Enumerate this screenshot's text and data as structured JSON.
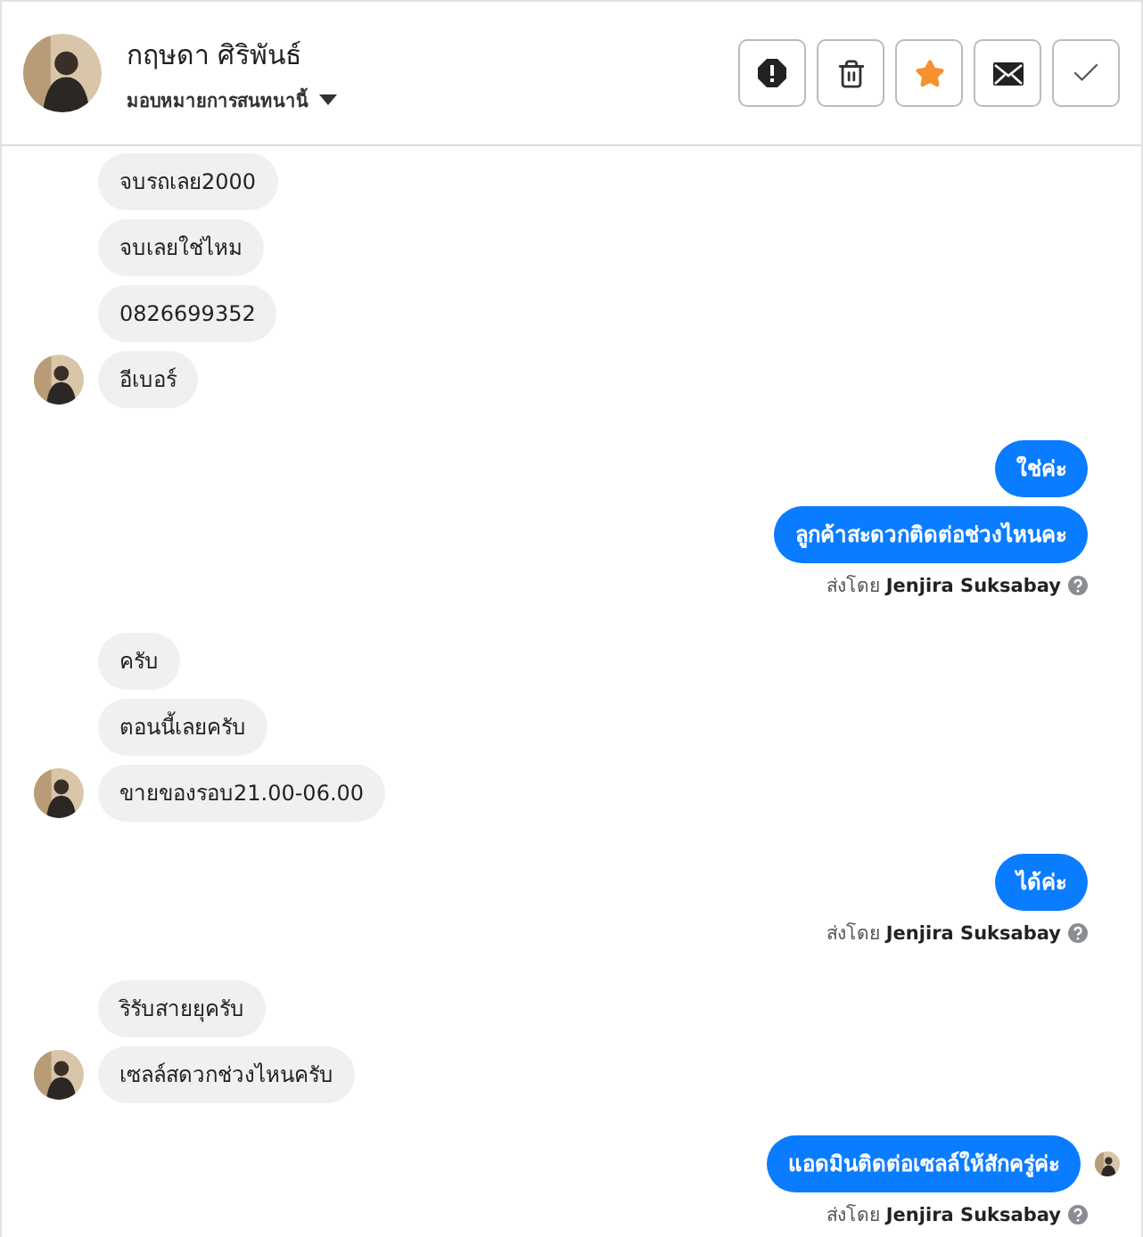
{
  "header": {
    "name": "กฤษดา ศิริพันธ์",
    "assign_label": "มอบหมายการสนทนานี้",
    "actions": [
      {
        "kind": "spam"
      },
      {
        "kind": "delete"
      },
      {
        "kind": "star",
        "selected": true
      },
      {
        "kind": "unread"
      },
      {
        "kind": "done"
      }
    ]
  },
  "groups": [
    {
      "kind": "incoming",
      "messages": [
        "จบรถเลย2000",
        "จบเลยใช่ไหม",
        "0826699352",
        "อีเบอร์"
      ]
    },
    {
      "kind": "outgoing",
      "messages": [
        "ใช่ค่ะ",
        "ลูกค้าสะดวกติดต่อช่วงไหนคะ"
      ],
      "sent_by_label": "ส่งโดย",
      "sender": "Jenjira Suksabay",
      "seen": false
    },
    {
      "kind": "incoming",
      "messages": [
        "ครับ",
        "ตอนนี้เลยครับ",
        "ขายของรอบ21.00-06.00"
      ]
    },
    {
      "kind": "outgoing",
      "messages": [
        "ได้ค่ะ"
      ],
      "sent_by_label": "ส่งโดย",
      "sender": "Jenjira Suksabay",
      "seen": false
    },
    {
      "kind": "incoming",
      "messages": [
        "ริรับสายยุครับ",
        "เซลล์สดวกช่วงไหนครับ"
      ]
    },
    {
      "kind": "outgoing",
      "messages": [
        "แอดมินติดต่อเซลล์ให้สักครู่ค่ะ"
      ],
      "sent_by_label": "ส่งโดย",
      "sender": "Jenjira Suksabay",
      "seen": true
    }
  ]
}
